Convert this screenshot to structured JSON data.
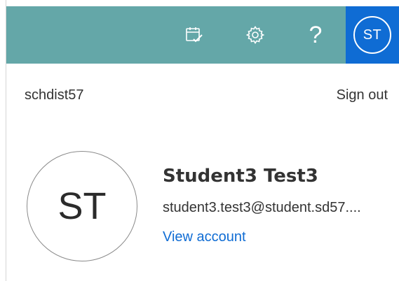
{
  "header": {
    "icons": {
      "calendar": "calendar-check-icon",
      "settings": "gear-icon",
      "help": "help-icon"
    },
    "help_glyph": "?",
    "me_initials": "ST",
    "colors": {
      "bar": "#64a7a8",
      "me_tile": "#0f6cd4"
    }
  },
  "account_panel": {
    "tenant": "schdist57",
    "sign_out_label": "Sign out",
    "avatar_initials": "ST",
    "display_name": "Student3 Test3",
    "email": "student3.test3@student.sd57....",
    "view_account_label": "View account",
    "link_color": "#0f6cd4"
  }
}
